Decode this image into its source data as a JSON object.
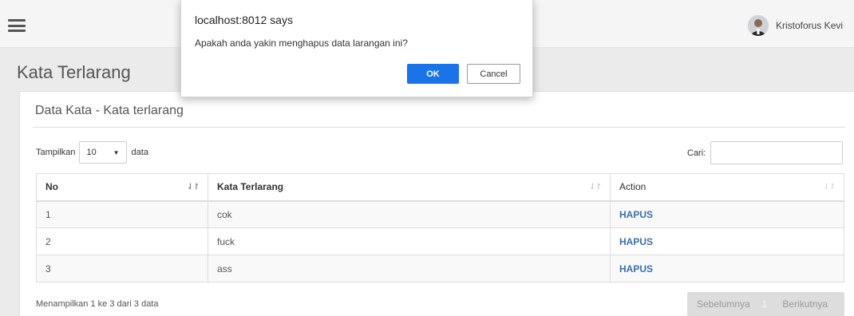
{
  "user": {
    "name": "Kristoforus Kevi"
  },
  "page": {
    "title": "Kata Terlarang"
  },
  "card": {
    "title": "Data Kata - Kata terlarang"
  },
  "length": {
    "prefix": "Tampilkan",
    "value": "10",
    "suffix": "data"
  },
  "search": {
    "label": "Cari:",
    "value": ""
  },
  "table": {
    "headers": {
      "no": "No",
      "kata": "Kata Terlarang",
      "action": "Action"
    },
    "rows": [
      {
        "no": "1",
        "kata": "cok",
        "action": "HAPUS"
      },
      {
        "no": "2",
        "kata": "fuck",
        "action": "HAPUS"
      },
      {
        "no": "3",
        "kata": "ass",
        "action": "HAPUS"
      }
    ]
  },
  "info": "Menampilkan 1 ke 3 dari 3 data",
  "pagination": {
    "prev": "Sebelumnya",
    "current": "1",
    "next": "Berikutnya"
  },
  "dialog": {
    "title": "localhost:8012 says",
    "message": "Apakah anda yakin menghapus data larangan ini?",
    "ok": "OK",
    "cancel": "Cancel"
  },
  "colors": {
    "ok_button": "#1a73e8",
    "link": "#3a6fb0",
    "topbar": "#f5f5f5"
  },
  "icons": {
    "menu": "hamburger-icon",
    "sort": "sort-icon",
    "select": "caret-down-icon",
    "avatar": "user-avatar"
  }
}
